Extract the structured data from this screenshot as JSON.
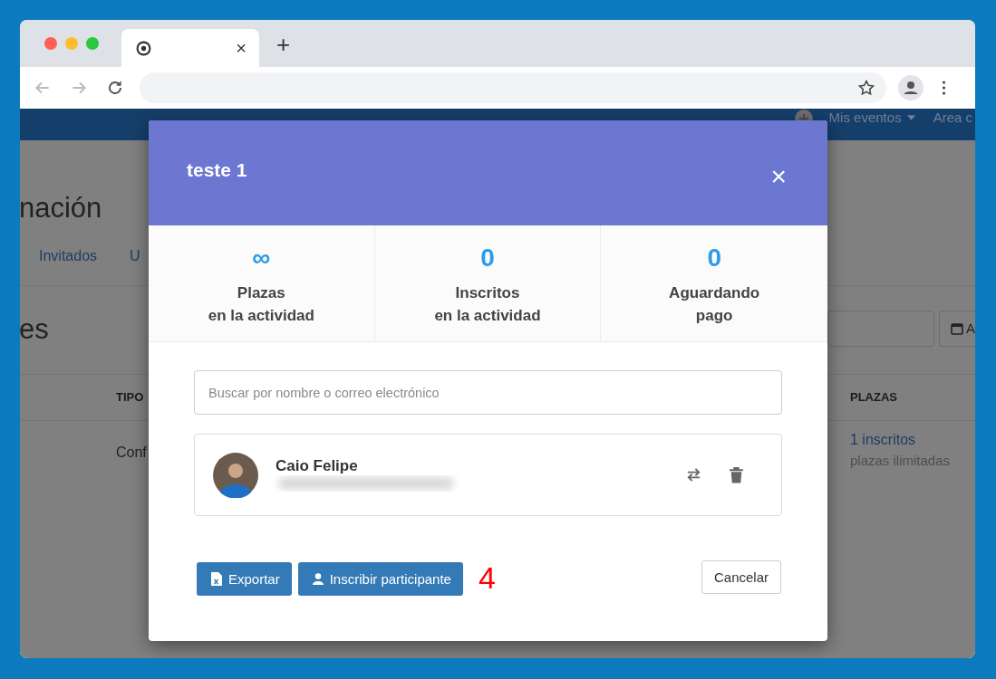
{
  "browser": {
    "tab": {
      "close": "×"
    },
    "new_tab": "+"
  },
  "page": {
    "navbar": {
      "items": [
        {
          "label": "Mis eventos",
          "kind": "dropdown"
        },
        {
          "label": "Area c",
          "kind": "link"
        }
      ]
    },
    "heading": "nación",
    "tabs": [
      "Invitados",
      "U"
    ],
    "section_title": "es",
    "date_button": "A",
    "table": {
      "columns": [
        "TIPO",
        "PLAZAS"
      ],
      "rows": [
        {
          "tipo": "Conf",
          "plazas": "1 inscritos",
          "plazas_note": "plazas ilimitadas"
        }
      ]
    }
  },
  "modal": {
    "title": "teste 1",
    "close": "×",
    "stats": [
      {
        "value": "∞",
        "label_lines": [
          "Plazas",
          "en la actividad"
        ]
      },
      {
        "value": "0",
        "label_lines": [
          "Inscritos",
          "en la actividad"
        ]
      },
      {
        "value": "0",
        "label_lines": [
          "Aguardando",
          "pago"
        ]
      }
    ],
    "search": {
      "placeholder": "Buscar por nombre o correo electrónico"
    },
    "participants": [
      {
        "name": "Caio Felipe"
      }
    ],
    "buttons": [
      {
        "label": "Exportar",
        "kind": "primary"
      },
      {
        "label": "Inscribir participante",
        "kind": "primary"
      },
      {
        "label": "Cancelar",
        "kind": "default"
      }
    ],
    "annotation": "4"
  }
}
